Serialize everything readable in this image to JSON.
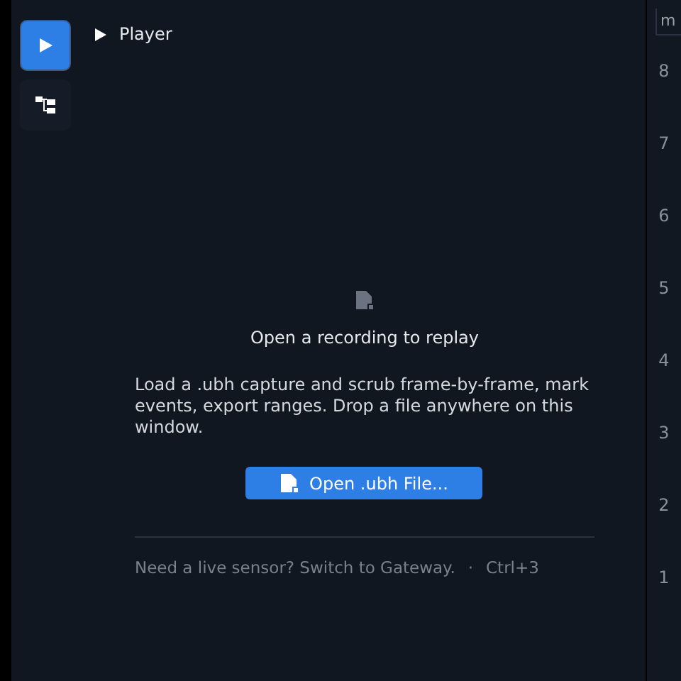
{
  "sidebar": {
    "items": [
      {
        "kind": "play",
        "selected": true
      },
      {
        "kind": "tree",
        "selected": false
      }
    ]
  },
  "panel": {
    "title": "Player",
    "expanded": false
  },
  "empty_state": {
    "heading": "Open a recording to replay",
    "body": "Load a .ubh capture and scrub frame-by-frame, mark events, export ranges. Drop a file anywhere on this window.",
    "button": "Open .ubh File...",
    "hint": "Need a live sensor? Switch to Gateway.",
    "separator": "·",
    "shortcut": "Ctrl+3"
  },
  "ruler": {
    "unit": "m",
    "ticks": [
      "8",
      "7",
      "6",
      "5",
      "4",
      "3",
      "2",
      "1"
    ]
  }
}
